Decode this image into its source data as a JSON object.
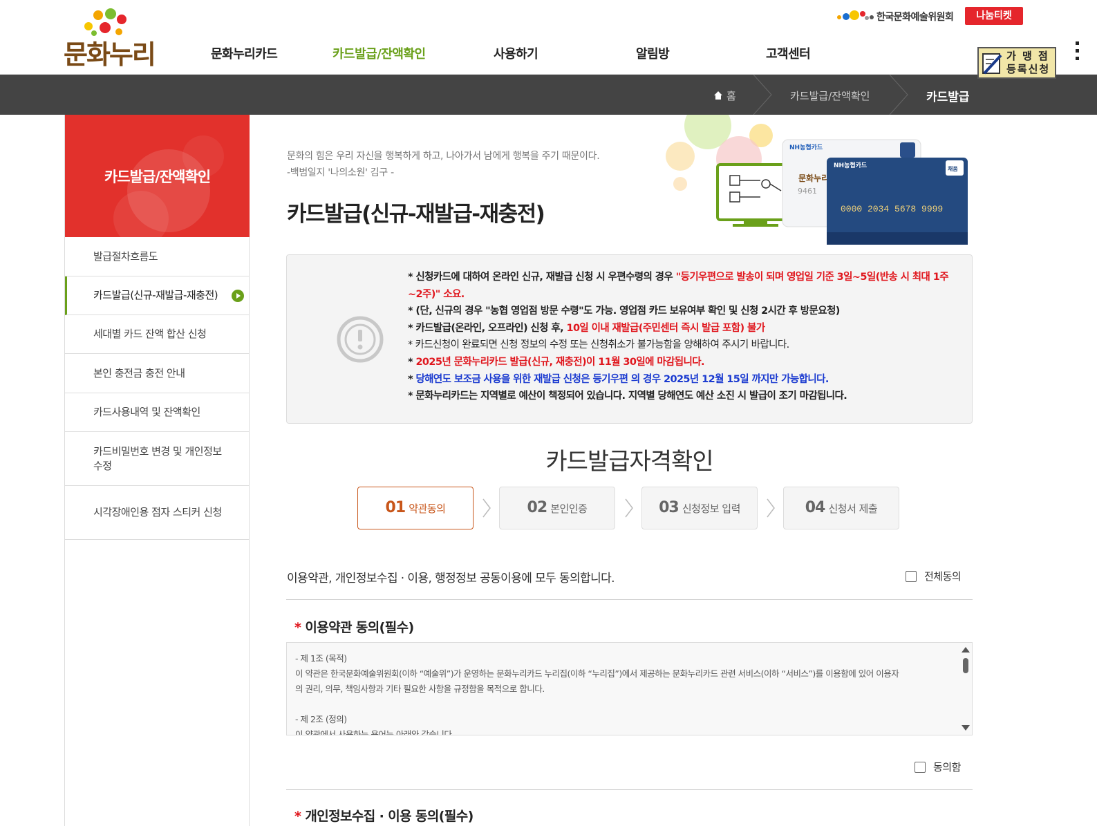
{
  "header": {
    "logo_text": "문화누리",
    "nav": [
      "문화누리카드",
      "카드발급/잔액확인",
      "사용하기",
      "알림방",
      "고객센터"
    ],
    "org_name": "한국문화예술위원회",
    "ticket_label": "나눔티켓",
    "merchant_label_line1": "가 맹 점",
    "merchant_label_line2": "등록신청"
  },
  "breadcrumb": {
    "home": "홈",
    "level1": "카드발급/잔액확인",
    "current": "카드발급"
  },
  "sidebar": {
    "title": "카드발급/잔액확인",
    "items": [
      {
        "label": "발급절차흐름도"
      },
      {
        "label": "카드발급(신규-재발급-재충전)"
      },
      {
        "label": "세대별 카드 잔액 합산 신청"
      },
      {
        "label": "본인 충전금 충전 안내"
      },
      {
        "label": "카드사용내역 및 잔액확인"
      },
      {
        "label": "카드비밀번호 변경 및 개인정보수정"
      },
      {
        "label": "시각장애인용 점자 스티커 신청"
      }
    ]
  },
  "main": {
    "quote_line1": "문화의 힘은 우리 자신을 행복하게 하고, 나아가서 남에게 행복을 주기 때문이다.",
    "quote_line2": "-백범일지 '나의소원' 김구 -",
    "title": "카드발급(신규-재발급-재충전)",
    "card_visual": {
      "card1_brand": "NH농협카드",
      "card1_logo": "문화누리",
      "card1_partial_number": "9461",
      "card2_brand": "NH농협카드",
      "card2_number": "0000 2034 5678 9999",
      "card_badge": "채움"
    },
    "notice": {
      "l1a": "* 신청카드에 대하여 온라인 신규, 재발급 신청 시 우편수령의 경우 ",
      "l1b": "\"등기우편으로 발송이 되며 영업일 기준 3일~5일(반송 시 최대 1주~2주)\"",
      "l1c": " 소요.",
      "l2": "* (단, 신규의 경우 \"농협 영업점 방문 수령\"도 가능. 영업점 카드 보유여부 확인 및 신청 2시간 후 방문요청)",
      "l3a": "* 카드발급(온라인, 오프라인) 신청 후, ",
      "l3b": "10일 이내 재발급(주민센터 즉시 발급 포함) 불가",
      "l4": "* 카드신청이 완료되면 신청 정보의 수정 또는 신청취소가 불가능함을 양해하여 주시기 바랍니다.",
      "l5a": "* ",
      "l5b": "2025년 문화누리카드 발급(신규, 재충전)이 11월 30일에 마감됩니다.",
      "l6a": "* ",
      "l6b": "당해연도 보조금 사용을 위한 재발급 신청은 등기우편 의 경우 2025년 12월 15일 까지만 가능합니다.",
      "l7": "* 문화누리카드는 지역별로 예산이 책정되어 있습니다. 지역별 당해연도 예산 소진 시 발급이 조기 마감됩니다."
    },
    "section_title": "카드발급자격확인",
    "steps": [
      {
        "num": "01",
        "label": "약관동의"
      },
      {
        "num": "02",
        "label": "본인인증"
      },
      {
        "num": "03",
        "label": "신청정보 입력"
      },
      {
        "num": "04",
        "label": "신청서 제출"
      }
    ],
    "agree_all_text": "이용약관, 개인정보수집 · 이용, 행정정보 공동이용에 모두 동의합니다.",
    "agree_all_checkbox": "전체동의",
    "terms1_title": "이용약관 동의(필수)",
    "terms1_lines": [
      "- 제 1조 (목적)",
      "이 약관은 한국문화예술위원회(이하 “예술위”)가 운영하는 문화누리카드 누리집(이하 “누리집”)에서 제공하는 문화누리카드 관련 서비스(이하 “서비스”)를 이용함에 있어 이용자",
      "의 권리, 의무, 책임사항과 기타 필요한 사항을 규정함을 목적으로 합니다.",
      "",
      "- 제 2조 (정의)",
      "이 약관에서 사용하는 용어는 아래와 같습니다."
    ],
    "agree_checkbox": "동의함",
    "terms2_title": "개인정보수집 · 이용 동의(필수)",
    "required_mark": "*"
  },
  "colors": {
    "accent_green": "#6aa01a",
    "sidebar_red": "#e2312c",
    "step_orange": "#c8561a",
    "notice_red": "#e0161d",
    "notice_blue": "#1a3ad0"
  }
}
